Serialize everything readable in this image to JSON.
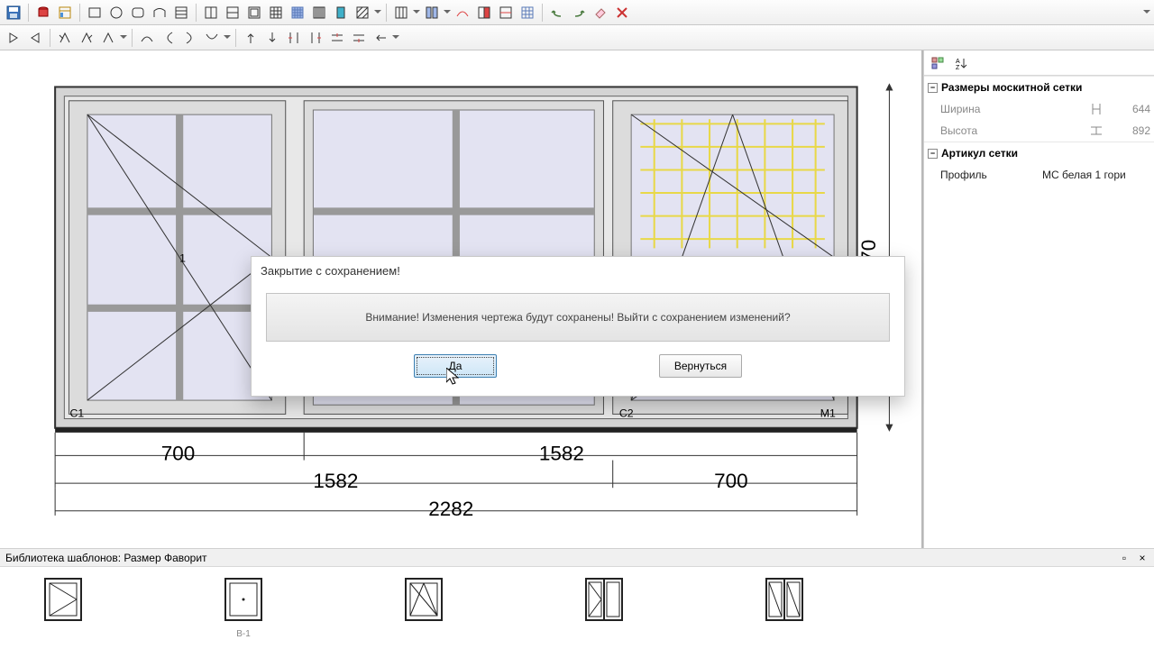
{
  "toolbar": {},
  "side": {
    "group1_title": "Размеры москитной сетки",
    "width_label": "Ширина",
    "width_val": "644",
    "height_label": "Высота",
    "height_val": "892",
    "group2_title": "Артикул сетки",
    "profile_label": "Профиль",
    "profile_val": "МС белая 1 гори"
  },
  "dialog": {
    "title": "Закрытие с сохранением!",
    "message": "Внимание! Изменения чертежа будут сохранены! Выйти с сохранением изменений?",
    "yes": "Да",
    "back": "Вернуться"
  },
  "library": {
    "title": "Библиотека шаблонов: Размер Фаворит",
    "item2_caption": "B-1"
  },
  "dims": {
    "w_left": "700",
    "w_right": "1582",
    "w_mid_left": "1582",
    "w_mid_right": "700",
    "w_total": "2282",
    "h_total": "70",
    "c1": "C1",
    "c2": "C2",
    "m1": "M1",
    "one": "1"
  }
}
